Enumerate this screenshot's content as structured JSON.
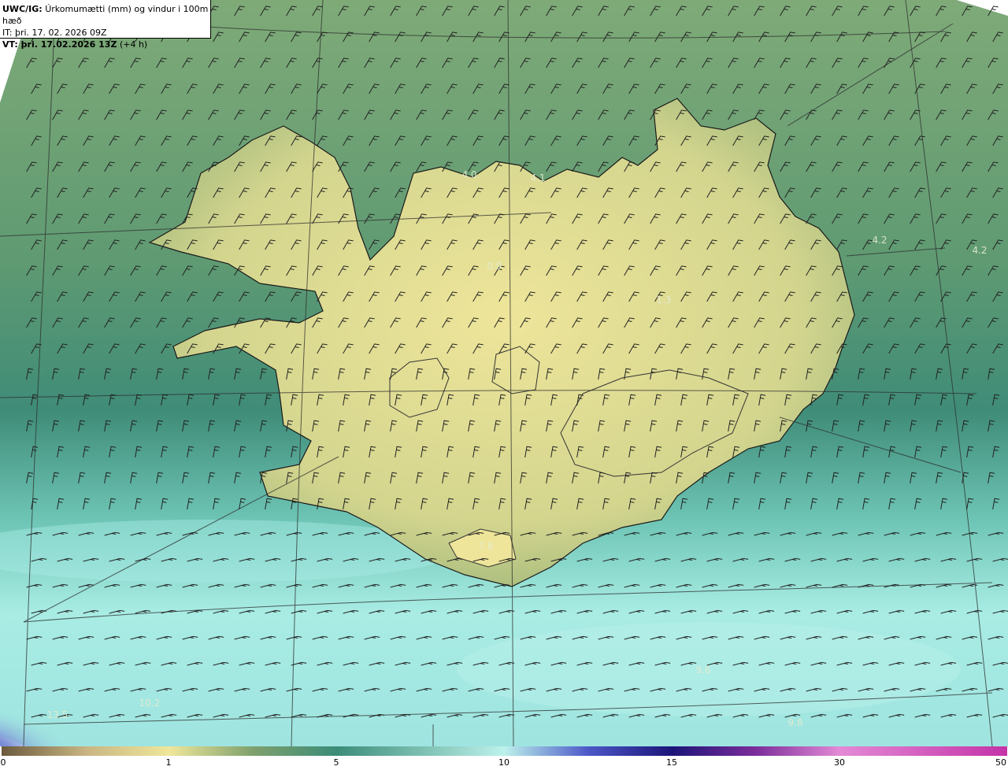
{
  "header": {
    "product": "UWC/IG:",
    "title": "Úrkomumætti (mm) og vindur i 100m hæð",
    "init_line": "IT: þri. 17. 02. 2026 09Z",
    "valid_prefix": "VT: þri. 17.02.2026 13Z",
    "valid_suffix": "(+4 h)"
  },
  "value_labels": [
    "4.0",
    "4.1",
    "4.2",
    "4.2",
    "0.9",
    "1.3",
    "7.8",
    "9.6",
    "9.8",
    "13.5",
    "10.2"
  ],
  "colorbar": {
    "ticks": [
      "0",
      "1",
      "5",
      "10",
      "15",
      "30",
      "50"
    ],
    "colors": {
      "brown": "#6b5a3e",
      "tan": "#c9b582",
      "pale_yellow": "#efe79a",
      "olive": "#7fa06d",
      "teal": "#3b8c78",
      "light_cyan": "#bdf2ec",
      "blue": "#4c58c8",
      "navy": "#1c1478",
      "violet": "#7b2d9a",
      "pink": "#e38ad6",
      "magenta": "#c433a8"
    }
  }
}
